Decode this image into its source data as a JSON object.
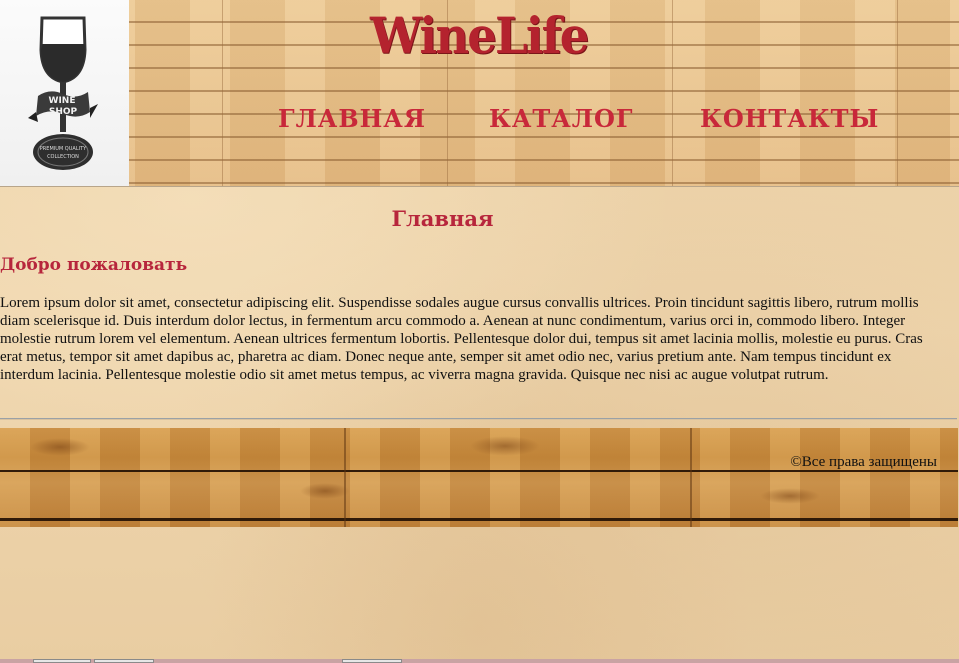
{
  "header": {
    "brand": "WineLife",
    "logo": {
      "line1": "WINE",
      "line2": "SHOP",
      "line3": "PREMIUM QUALITY",
      "line4": "COLLECTION"
    },
    "nav": [
      {
        "label": "ГЛАВНАЯ"
      },
      {
        "label": "КАТАЛОГ"
      },
      {
        "label": "КОНТАКТЫ"
      }
    ]
  },
  "main": {
    "title": "Главная",
    "welcome": "Добро пожаловать",
    "body": "Lorem ipsum dolor sit amet, consectetur adipiscing elit. Suspendisse sodales augue cursus convallis ultrices. Proin tincidunt sagittis libero, rutrum mollis diam scelerisque id. Duis interdum dolor lectus, in fermentum arcu commodo a. Aenean at nunc condimentum, varius orci in, commodo libero. Integer molestie rutrum lorem vel elementum. Aenean ultrices fermentum lobortis. Pellentesque dolor dui, tempus sit amet lacinia mollis, molestie eu purus. Cras erat metus, tempor sit amet dapibus ac, pharetra ac diam. Donec neque ante, semper sit amet odio nec, varius pretium ante. Nam tempus tincidunt ex interdum lacinia. Pellentesque molestie odio sit amet metus tempus, ac viverra magna gravida. Quisque nec nisi ac augue volutpat rutrum."
  },
  "footer": {
    "copyright": "©Все права защищены"
  },
  "colors": {
    "brand": "#b4232e",
    "nav": "#c8283a",
    "heading": "#b7263c",
    "paper": "#ecd2a8",
    "wood_header": "#e8c38e",
    "wood_footer": "#c98d3f"
  }
}
